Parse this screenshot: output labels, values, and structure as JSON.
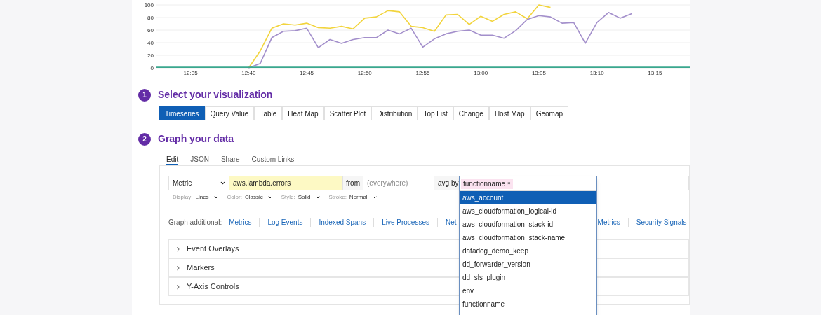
{
  "chart": {
    "chart_data": {
      "type": "line",
      "categories": [
        null,
        null,
        null,
        "12:35",
        null,
        null,
        null,
        null,
        "12:40",
        null,
        null,
        null,
        null,
        "12:45",
        null,
        null,
        null,
        null,
        "12:50",
        null,
        null,
        null,
        null,
        "12:55",
        null,
        null,
        null,
        null,
        "13:00",
        null,
        null,
        null,
        null,
        "13:05",
        null,
        null,
        null,
        null,
        "13:10",
        null,
        null,
        null,
        null,
        "13:15",
        null,
        null,
        null
      ],
      "ylim": [
        0,
        100
      ],
      "yticks": [
        0,
        20,
        40,
        60,
        80,
        100
      ],
      "grid": true,
      "series": [
        {
          "color": "#f2d43d",
          "values": [
            null,
            null,
            null,
            null,
            null,
            null,
            null,
            null,
            0,
            27,
            63,
            70,
            68,
            71,
            64,
            63,
            66,
            62,
            79,
            81,
            91,
            89,
            66,
            64,
            58,
            84,
            85,
            69,
            82,
            74,
            85,
            89,
            78,
            100,
            96,
            null,
            null,
            null,
            null,
            null,
            null,
            null,
            null,
            null,
            null,
            null,
            null
          ]
        },
        {
          "color": "#a38fcb",
          "values": [
            null,
            null,
            null,
            null,
            null,
            null,
            null,
            null,
            0,
            7,
            48,
            58,
            59,
            63,
            32,
            45,
            39,
            45,
            48,
            48,
            60,
            54,
            63,
            33,
            46,
            54,
            58,
            60,
            52,
            52,
            47,
            59,
            77,
            83,
            81,
            71,
            72,
            39,
            72,
            88,
            79,
            86,
            null,
            null,
            null,
            null,
            null
          ]
        },
        {
          "color": "#3aa78e",
          "values": [
            1,
            1,
            1,
            1,
            1,
            1,
            1,
            1,
            1,
            1,
            1,
            1,
            1,
            1,
            1,
            1,
            1,
            1,
            1,
            1,
            1,
            1,
            1,
            1,
            1,
            1,
            1,
            1,
            1,
            1,
            1,
            1,
            1,
            1,
            1,
            1,
            1,
            1,
            1,
            1,
            1,
            1,
            1,
            1,
            1,
            1,
            1
          ]
        }
      ]
    }
  },
  "steps": [
    {
      "number": "1",
      "title": "Select your visualization"
    },
    {
      "number": "2",
      "title": "Graph your data"
    }
  ],
  "visualizations": [
    {
      "label": "Timeseries",
      "selected": true
    },
    {
      "label": "Query Value",
      "selected": false
    },
    {
      "label": "Table",
      "selected": false
    },
    {
      "label": "Heat Map",
      "selected": false
    },
    {
      "label": "Scatter Plot",
      "selected": false
    },
    {
      "label": "Distribution",
      "selected": false
    },
    {
      "label": "Top List",
      "selected": false
    },
    {
      "label": "Change",
      "selected": false
    },
    {
      "label": "Host Map",
      "selected": false
    },
    {
      "label": "Geomap",
      "selected": false
    }
  ],
  "editor_tabs": [
    {
      "label": "Edit",
      "selected": true
    },
    {
      "label": "JSON",
      "selected": false
    },
    {
      "label": "Share",
      "selected": false
    },
    {
      "label": "Custom Links",
      "selected": false
    }
  ],
  "query": {
    "source": "Metric",
    "metric": "aws.lambda.errors",
    "from_label": "from",
    "scope_placeholder": "(everywhere)",
    "agg_label": "avg by",
    "group_tag": "functionname",
    "group_tag_remove": "×"
  },
  "display_options": [
    {
      "label": "Display:",
      "value": "Lines"
    },
    {
      "label": "Color:",
      "value": "Classic"
    },
    {
      "label": "Style:",
      "value": "Solid"
    },
    {
      "label": "Stroke:",
      "value": "Normal"
    }
  ],
  "graph_additional": {
    "label": "Graph additional:",
    "links": [
      "Metrics",
      "Log Events",
      "Indexed Spans",
      "Live Processes",
      "Net",
      "Metrics",
      "Security Signals"
    ]
  },
  "sections": [
    {
      "label": "Event Overlays",
      "expanded": false
    },
    {
      "label": "Markers",
      "expanded": false
    },
    {
      "label": "Y-Axis Controls",
      "expanded": false
    }
  ],
  "tag_dropdown": [
    {
      "label": "aws_account",
      "selected": true
    },
    {
      "label": "aws_cloudformation_logical-id",
      "selected": false
    },
    {
      "label": "aws_cloudformation_stack-id",
      "selected": false
    },
    {
      "label": "aws_cloudformation_stack-name",
      "selected": false
    },
    {
      "label": "datadog_demo_keep",
      "selected": false
    },
    {
      "label": "dd_forwarder_version",
      "selected": false
    },
    {
      "label": "dd_sls_plugin",
      "selected": false
    },
    {
      "label": "env",
      "selected": false
    },
    {
      "label": "functionname",
      "selected": false
    }
  ]
}
